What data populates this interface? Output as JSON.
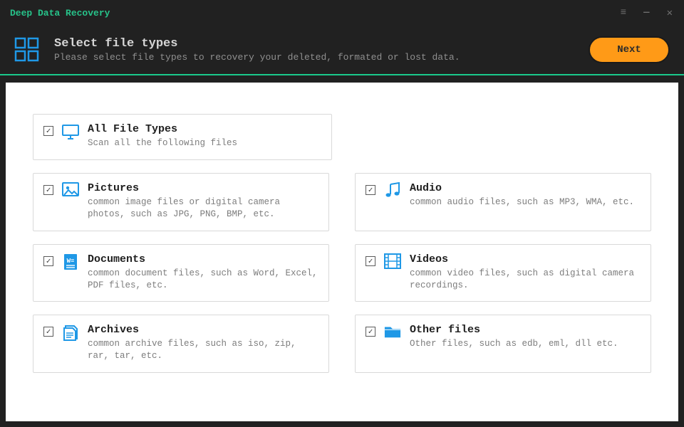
{
  "app": {
    "title": "Deep Data Recovery"
  },
  "header": {
    "heading": "Select file types",
    "subheading": "Please select file types to recovery your deleted, formated or lost data.",
    "next_label": "Next"
  },
  "allCard": {
    "title": "All File Types",
    "desc": "Scan all the following files"
  },
  "cards": [
    {
      "title": "Pictures",
      "desc": "common image files or digital camera photos, such as JPG, PNG, BMP, etc."
    },
    {
      "title": "Audio",
      "desc": "common audio files, such as MP3, WMA, etc."
    },
    {
      "title": "Documents",
      "desc": "common document files, such as Word, Excel, PDF files, etc."
    },
    {
      "title": "Videos",
      "desc": "common video files, such as digital camera recordings."
    },
    {
      "title": "Archives",
      "desc": "common archive files, such as iso, zip, rar, tar, etc."
    },
    {
      "title": "Other files",
      "desc": "Other files, such as edb, eml, dll etc."
    }
  ],
  "colors": {
    "accent": "#1ac98c",
    "primary_btn": "#ff9a17",
    "icon": "#1f98e6"
  }
}
